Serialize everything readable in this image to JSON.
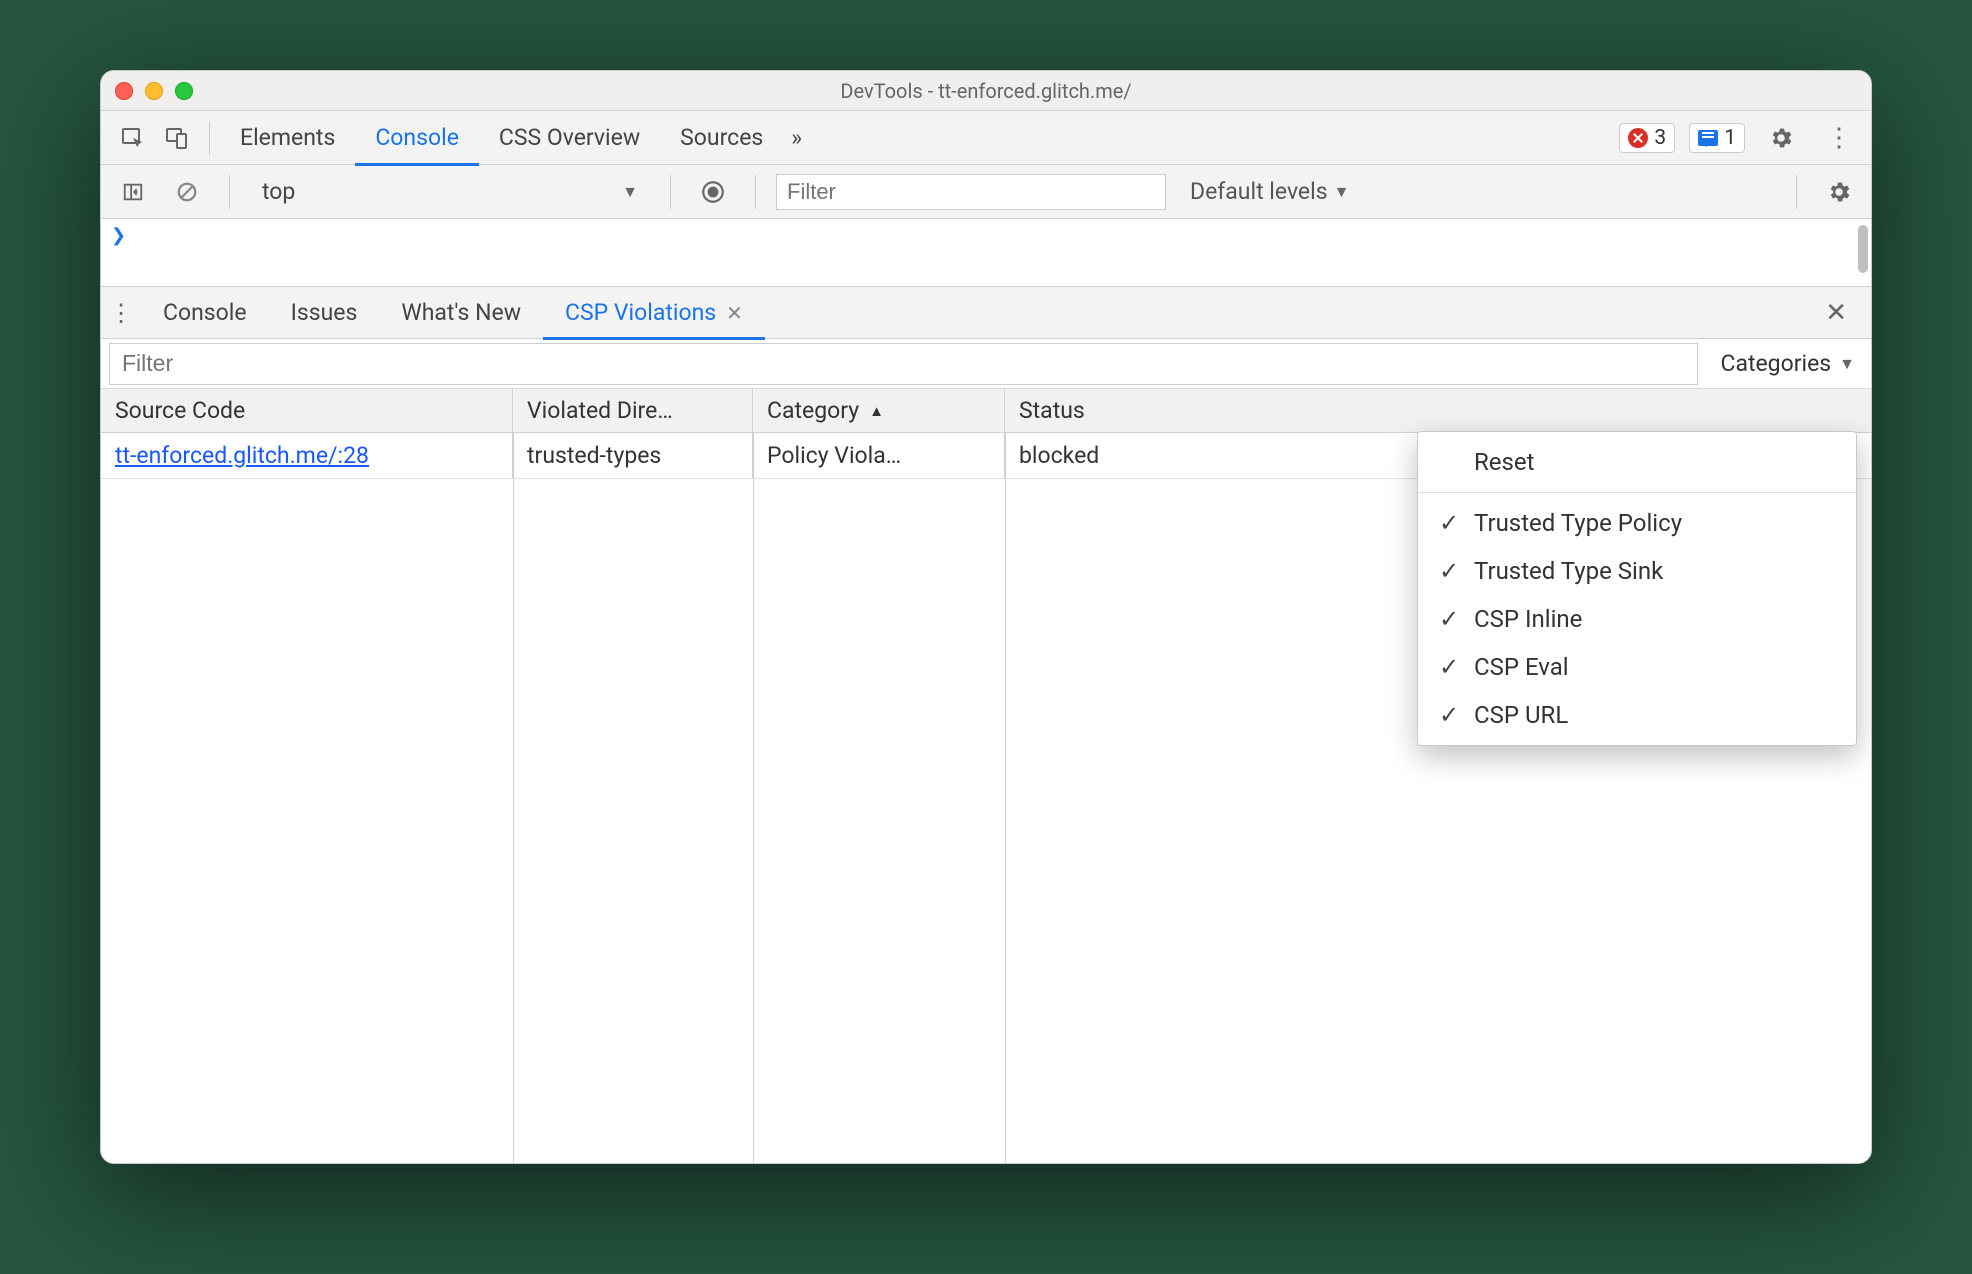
{
  "window": {
    "title": "DevTools - tt-enforced.glitch.me/"
  },
  "mainTabs": {
    "items": [
      "Elements",
      "Console",
      "CSS Overview",
      "Sources"
    ],
    "activeIndex": 1,
    "overflow": "»",
    "errors": "3",
    "messages": "1"
  },
  "consoleBar": {
    "context": "top",
    "filterPlaceholder": "Filter",
    "levels": "Default levels"
  },
  "drawerTabs": {
    "items": [
      "Console",
      "Issues",
      "What's New",
      "CSP Violations"
    ],
    "activeIndex": 3
  },
  "violations": {
    "filterPlaceholder": "Filter",
    "categoriesLabel": "Categories",
    "columns": [
      "Source Code",
      "Violated Dire…",
      "Category",
      "Status"
    ],
    "rows": [
      {
        "source": "tt-enforced.glitch.me/:28",
        "directive": "trusted-types",
        "category": "Policy Viola…",
        "status": "blocked"
      }
    ]
  },
  "categoriesMenu": {
    "reset": "Reset",
    "items": [
      {
        "label": "Trusted Type Policy",
        "checked": true
      },
      {
        "label": "Trusted Type Sink",
        "checked": true
      },
      {
        "label": "CSP Inline",
        "checked": true
      },
      {
        "label": "CSP Eval",
        "checked": true
      },
      {
        "label": "CSP URL",
        "checked": true
      }
    ]
  }
}
